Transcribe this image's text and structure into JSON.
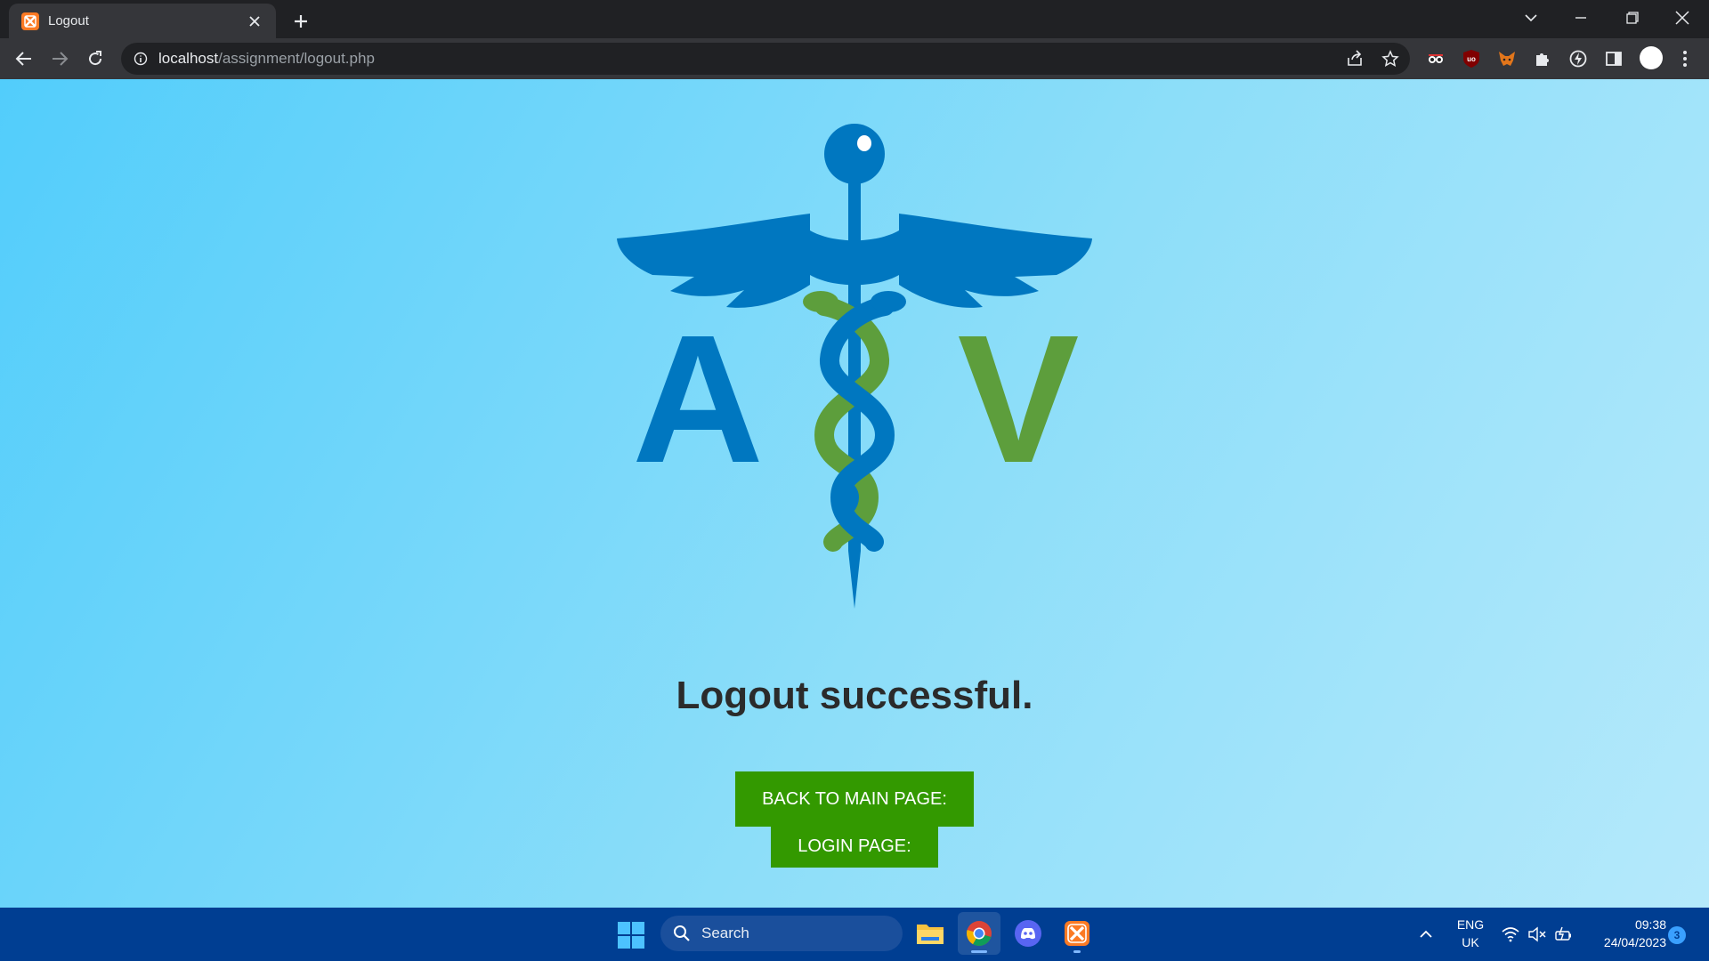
{
  "browser": {
    "tab": {
      "title": "Logout",
      "favicon": "xampp-icon"
    },
    "url_host": "localhost",
    "url_path": "/assignment/logout.php",
    "extensions": [
      "glasses-extension-icon",
      "ublock-icon",
      "metamask-icon",
      "puzzle-extensions-icon",
      "lightning-icon",
      "side-panel-icon",
      "profile-avatar",
      "menu-kebab-icon"
    ]
  },
  "page": {
    "logo": {
      "left_letter": "A",
      "right_letter": "V",
      "colors": {
        "blue": "#0077c0",
        "green": "#5d9e3c"
      }
    },
    "heading": "Logout successful.",
    "buttons": {
      "main": "BACK TO MAIN PAGE:",
      "login": "LOGIN PAGE:"
    },
    "colors": {
      "button": "#339900",
      "heading": "#2b2b2b"
    }
  },
  "taskbar": {
    "search_label": "Search",
    "apps": [
      "file-explorer-icon",
      "chrome-icon",
      "discord-icon",
      "xampp-icon"
    ],
    "language": [
      "ENG",
      "UK"
    ],
    "time": "09:38",
    "date": "24/04/2023",
    "notification_count": "3"
  }
}
